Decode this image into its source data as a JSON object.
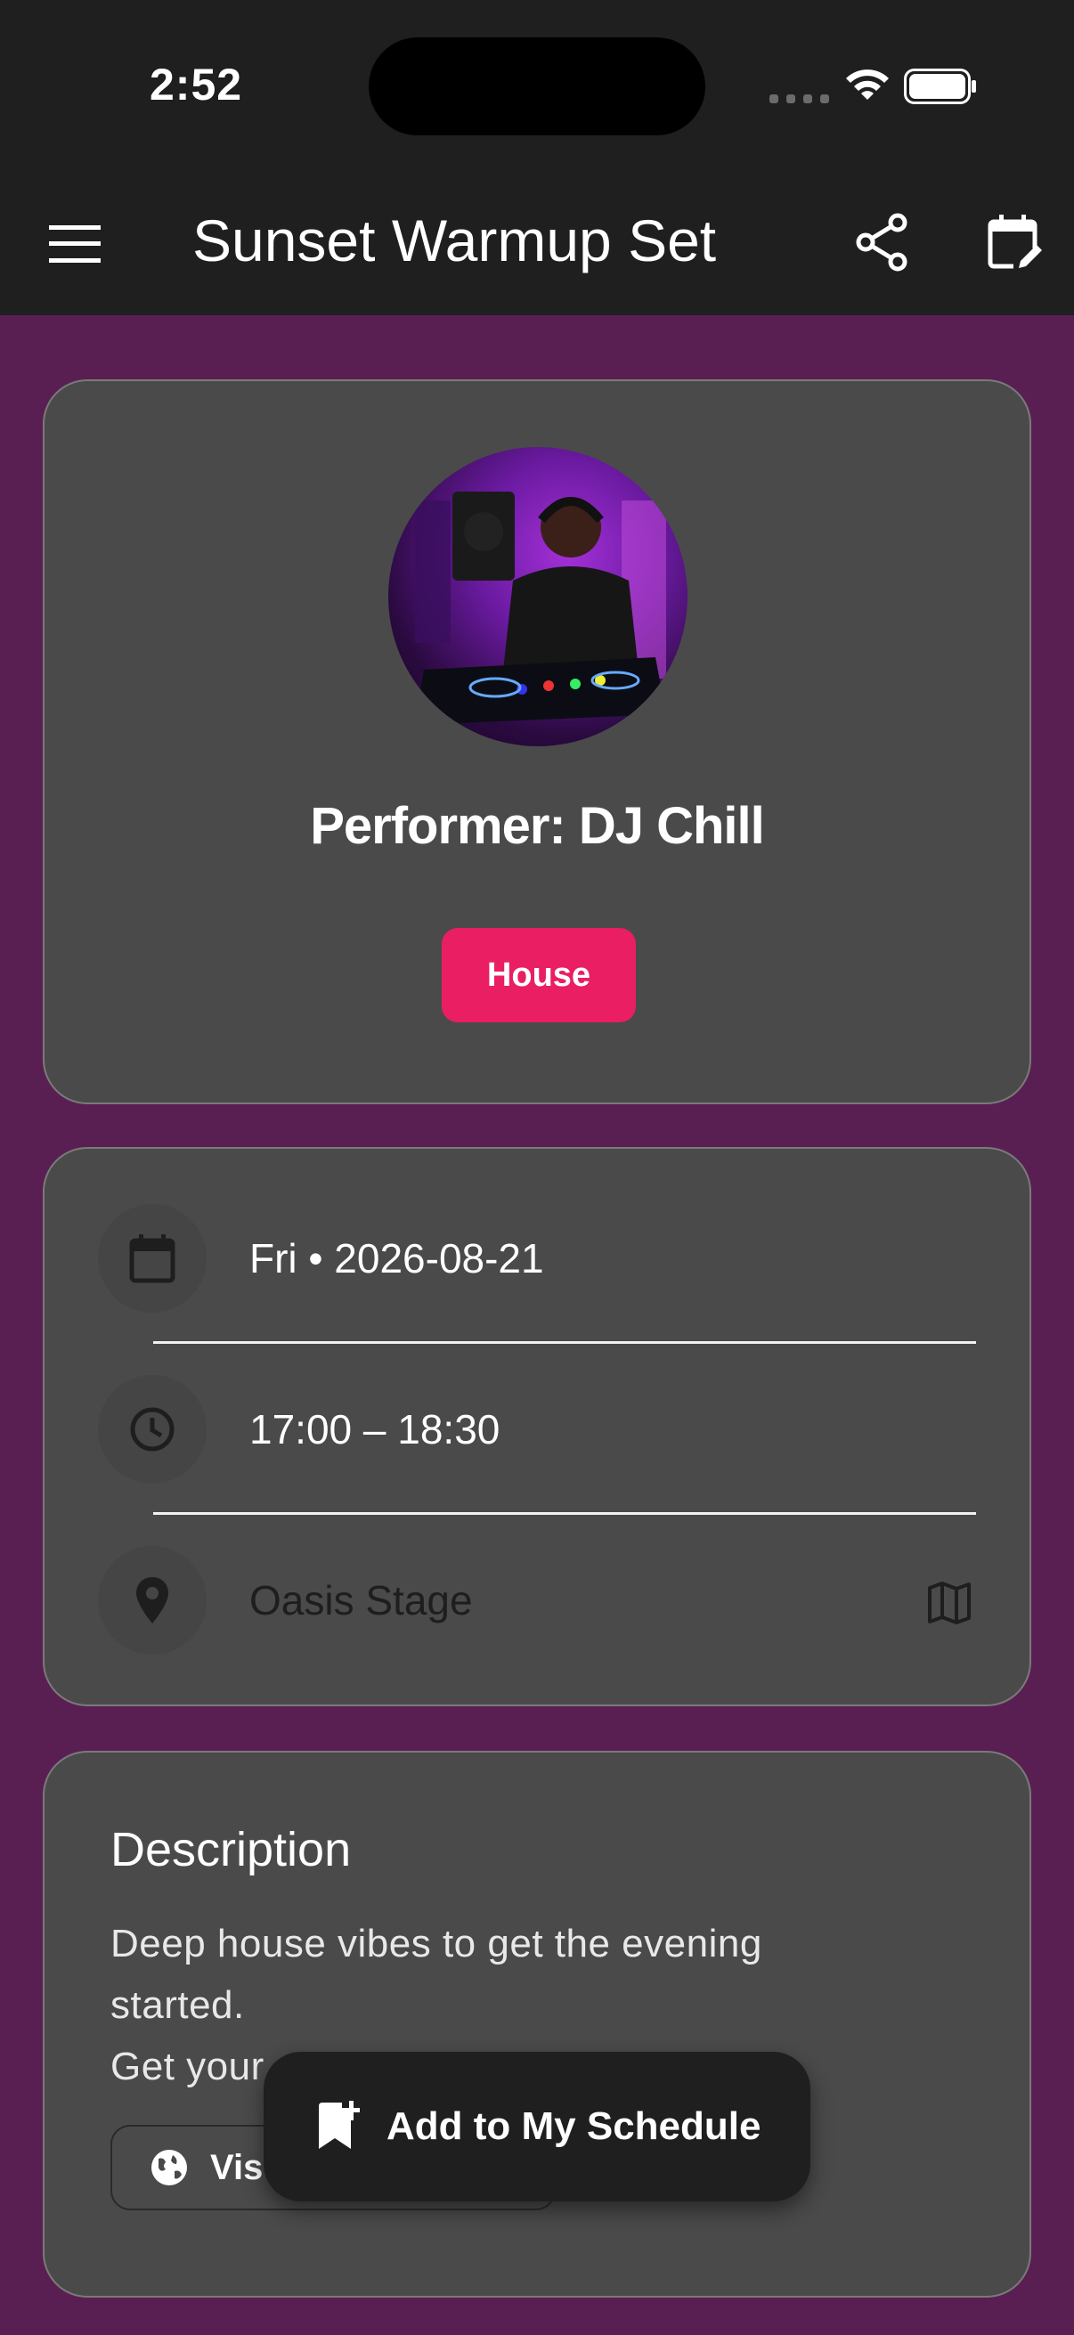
{
  "status_bar": {
    "time": "2:52"
  },
  "app_bar": {
    "title": "Sunset Warmup Set",
    "menu_icon": "menu-icon",
    "share_icon": "share-icon",
    "edit_calendar_icon": "edit-calendar-icon"
  },
  "performer": {
    "name": "Performer: DJ Chill",
    "genre": "House",
    "avatar": "dj-performer-photo"
  },
  "details": {
    "date": "Fri • 2026-08-21",
    "time": "17:00 – 18:30",
    "location": "Oasis Stage"
  },
  "description": {
    "title": "Description",
    "line1": "Deep house vibes to get the evening",
    "line2": "started.",
    "line3": "Get your",
    "visit_button_label": "Vis"
  },
  "fab": {
    "label": "Add to My Schedule"
  },
  "colors": {
    "background": "#5a1f52",
    "app_bar": "#1f1f1f",
    "card": "#4a4a4a",
    "genre_chip": "#e91e63"
  }
}
